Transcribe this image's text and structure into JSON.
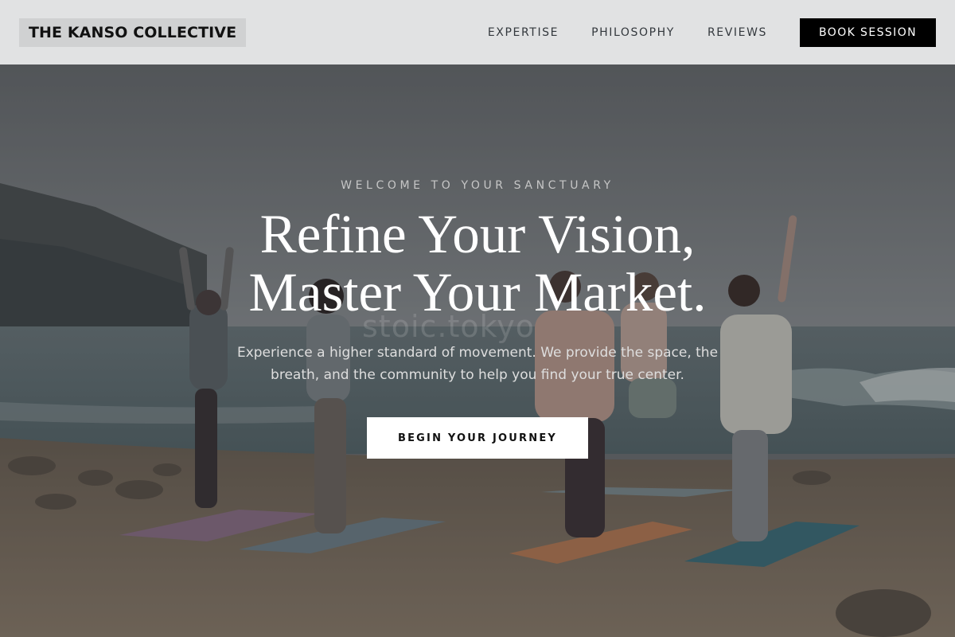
{
  "header": {
    "brand": "THE KANSO COLLECTIVE",
    "nav": [
      {
        "label": "EXPERTISE"
      },
      {
        "label": "PHILOSOPHY"
      },
      {
        "label": "REVIEWS"
      }
    ],
    "cta_label": "BOOK SESSION"
  },
  "hero": {
    "eyebrow": "WELCOME TO YOUR SANCTUARY",
    "headline_line1": "Refine Your Vision,",
    "headline_line2": "Master Your Market.",
    "subtext": "Experience a higher standard of movement. We provide the space, the breath, and the community to help you find your true center.",
    "cta_label": "BEGIN YOUR JOURNEY",
    "watermark": "stoic.tokyo",
    "background_image": "beach-yoga-group-tree-pose"
  },
  "colors": {
    "header_bg": "#e1e2e3",
    "brand_bg": "#d0d1d2",
    "cta_dark": "#000000",
    "hero_text": "#ffffff",
    "cta_light": "#ffffff"
  }
}
